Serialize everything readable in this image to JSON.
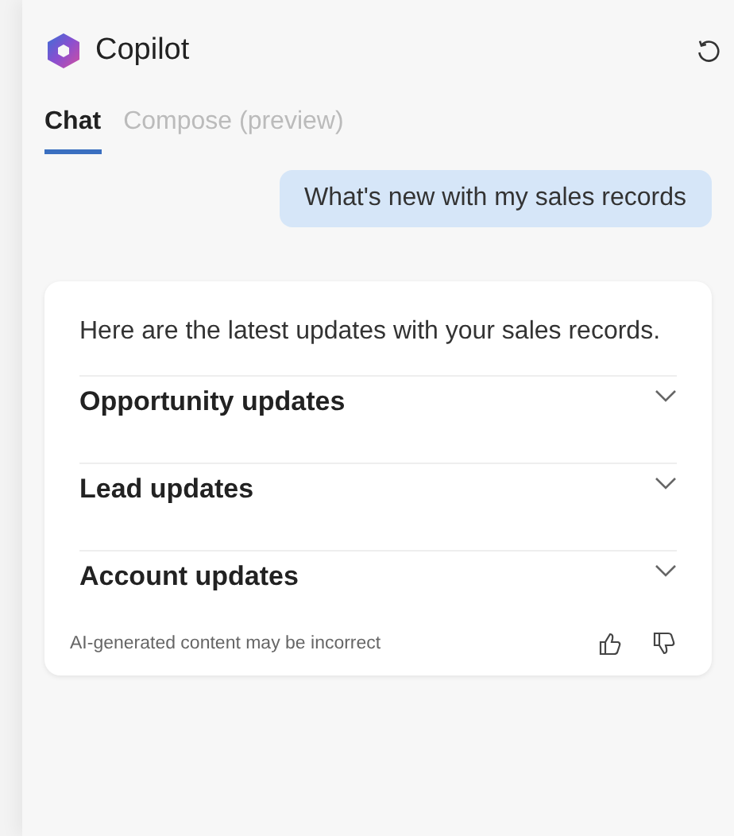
{
  "header": {
    "title": "Copilot"
  },
  "tabs": [
    {
      "label": "Chat",
      "selected": true
    },
    {
      "label": "Compose (preview)",
      "selected": false
    }
  ],
  "user_message": "What's new with my sales records",
  "response": {
    "text": "Here are the latest updates with your sales records.",
    "sections": [
      {
        "label": "Opportunity updates",
        "expanded": false
      },
      {
        "label": "Lead updates",
        "expanded": false
      },
      {
        "label": "Account updates",
        "expanded": false
      }
    ],
    "disclaimer": "AI-generated content may be incorrect"
  }
}
